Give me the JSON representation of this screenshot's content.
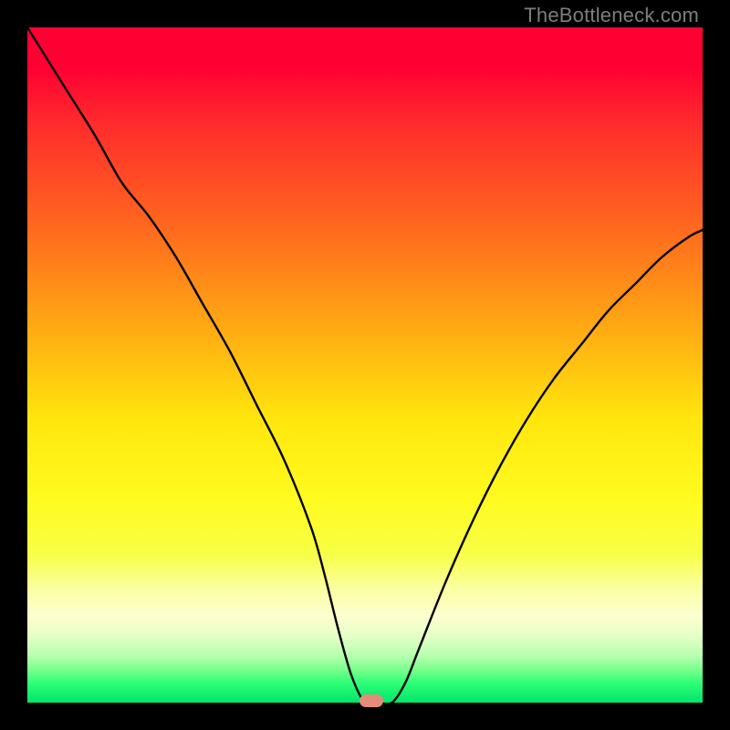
{
  "watermark": "TheBottleneck.com",
  "colors": {
    "frame": "#000000",
    "curve": "#000000",
    "marker": "#e58b7a",
    "gradient_top": "#ff0033",
    "gradient_bottom": "#00e56a"
  },
  "chart_data": {
    "type": "line",
    "title": "",
    "xlabel": "",
    "ylabel": "",
    "xlim": [
      0,
      100
    ],
    "ylim": [
      0,
      100
    ],
    "grid": false,
    "legend": false,
    "series": [
      {
        "name": "bottleneck-curve",
        "x": [
          0,
          5,
          10,
          14,
          18,
          22,
          26,
          30,
          34,
          38,
          42,
          44,
          46,
          48,
          50,
          52,
          54,
          56,
          58,
          62,
          66,
          70,
          74,
          78,
          82,
          86,
          90,
          94,
          98,
          100
        ],
        "values": [
          100,
          92,
          84,
          77,
          72,
          66,
          59,
          52,
          44,
          36,
          26,
          19,
          11,
          4,
          0,
          0,
          0,
          3,
          8,
          18,
          27,
          35,
          42,
          48,
          53,
          58,
          62,
          66,
          69,
          70
        ]
      }
    ],
    "annotations": [
      {
        "name": "optimal-marker",
        "x": 51,
        "y": 0
      }
    ]
  }
}
